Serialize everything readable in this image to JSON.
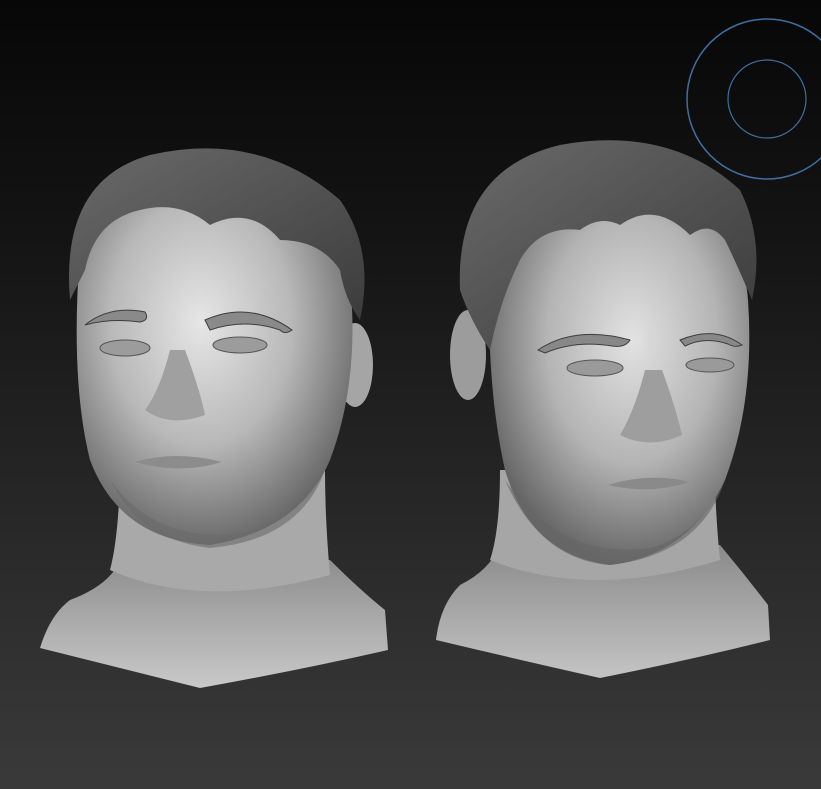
{
  "viewport": {
    "background_top": "#070707",
    "background_bottom": "#3a3a3a"
  },
  "models": [
    {
      "id": "head-sculpt-left",
      "view": "front-three-quarter"
    },
    {
      "id": "head-sculpt-right",
      "view": "three-quarter-right"
    }
  ],
  "brush_cursor": {
    "icon": "brush-radius-circle-icon",
    "color": "#3e6f9e"
  },
  "material": {
    "clay_light": "#cfcfcf",
    "clay_mid": "#9a9a9a",
    "clay_dark": "#4d4d4d",
    "hair": "#5a5a5a"
  }
}
